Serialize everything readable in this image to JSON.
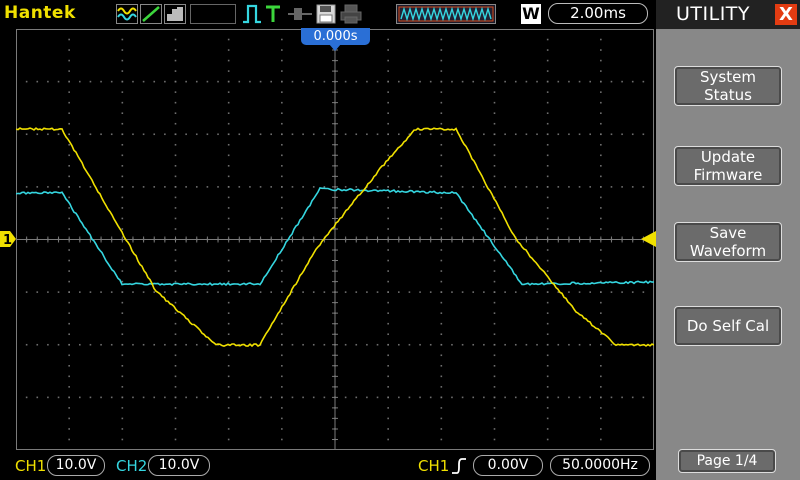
{
  "header": {
    "brand": "Hantek",
    "mode_letter": "W",
    "timebase": "2.00ms",
    "trigger_position": "0.000s"
  },
  "panel": {
    "title": "UTILITY",
    "close_label": "X",
    "buttons": [
      {
        "label": "System\nStatus"
      },
      {
        "label": "Update\nFirmware"
      },
      {
        "label": "Save\nWaveform"
      },
      {
        "label": "Do Self Cal"
      }
    ],
    "page_label": "Page 1/4"
  },
  "footer": {
    "ch1_label": "CH1",
    "ch1_scale": "10.0V",
    "ch2_label": "CH2",
    "ch2_scale": "10.0V",
    "trigger_source": "CH1",
    "trigger_level": "0.00V",
    "frequency": "50.0000Hz"
  },
  "markers": {
    "ch1_marker": "1"
  },
  "colors": {
    "ch1": "#f0e000",
    "ch2": "#35d6e0",
    "grid": "#7a7a7a",
    "accent": "#2a6fd6"
  },
  "icons": [
    "waveform-mode-icon",
    "ramp-icon",
    "display-icon",
    "trigger-edge-icon",
    "trigger-t-icon",
    "probe-icon",
    "save-icon",
    "print-icon",
    "memory-depth-icon"
  ]
}
